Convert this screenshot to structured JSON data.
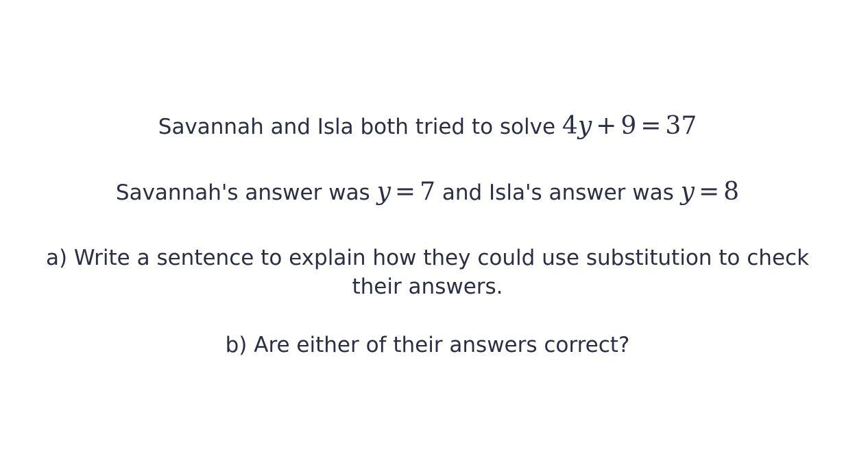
{
  "question": {
    "intro_text": "Savannah and Isla both tried to solve",
    "equation": {
      "coef": "4",
      "var": "y",
      "plus": "+",
      "constant": "9",
      "equals": "=",
      "rhs": "37"
    },
    "answers": {
      "prefix": "Savannah's answer was",
      "savannah_var": "y",
      "savannah_eq": "=",
      "savannah_value": "7",
      "middle": "and Isla's answer was",
      "isla_var": "y",
      "isla_eq": "=",
      "isla_value": "8"
    },
    "part_a_line1": "a) Write a sentence to explain how they could use substitution to check",
    "part_a_line2": "their answers.",
    "part_b": "b) Are either of their answers correct?"
  }
}
